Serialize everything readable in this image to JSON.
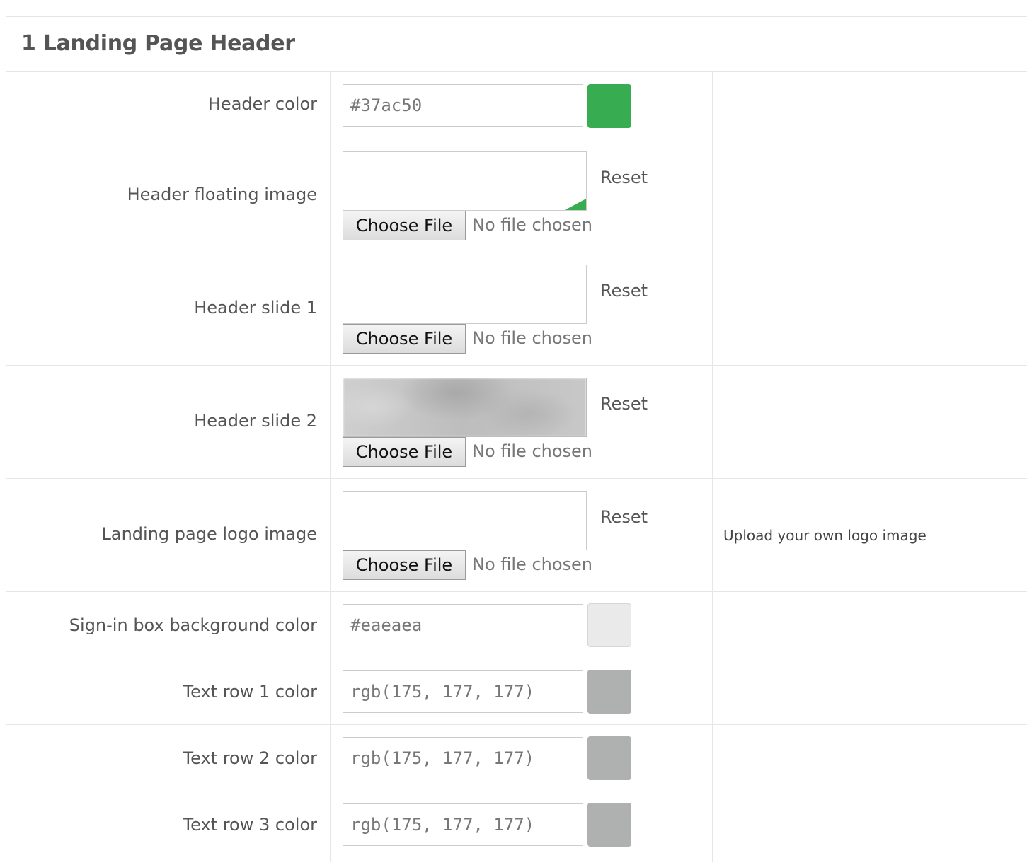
{
  "section": {
    "title": "1 Landing Page Header"
  },
  "rows": {
    "header_color": {
      "label": "Header color",
      "value": "#37ac50",
      "swatch": "#37ac50"
    },
    "header_floating_image": {
      "label": "Header floating image",
      "reset": "Reset",
      "choose_file": "Choose File",
      "no_file": "No file chosen"
    },
    "header_slide_1": {
      "label": "Header slide 1",
      "reset": "Reset",
      "choose_file": "Choose File",
      "no_file": "No file chosen"
    },
    "header_slide_2": {
      "label": "Header slide 2",
      "reset": "Reset",
      "choose_file": "Choose File",
      "no_file": "No file chosen"
    },
    "landing_logo_image": {
      "label": "Landing page logo image",
      "reset": "Reset",
      "choose_file": "Choose File",
      "no_file": "No file chosen",
      "help": "Upload your own logo image"
    },
    "signin_bg_color": {
      "label": "Sign-in box background color",
      "value": "#eaeaea",
      "swatch": "#eaeaea"
    },
    "text_row_1_color": {
      "label": "Text row 1 color",
      "value": "rgb(175, 177, 177)",
      "swatch": "#afb1b1"
    },
    "text_row_2_color": {
      "label": "Text row 2 color",
      "value": "rgb(175, 177, 177)",
      "swatch": "#afb1b1"
    },
    "text_row_3_color": {
      "label": "Text row 3 color",
      "value": "rgb(175, 177, 177)",
      "swatch": "#afb1b1"
    }
  }
}
